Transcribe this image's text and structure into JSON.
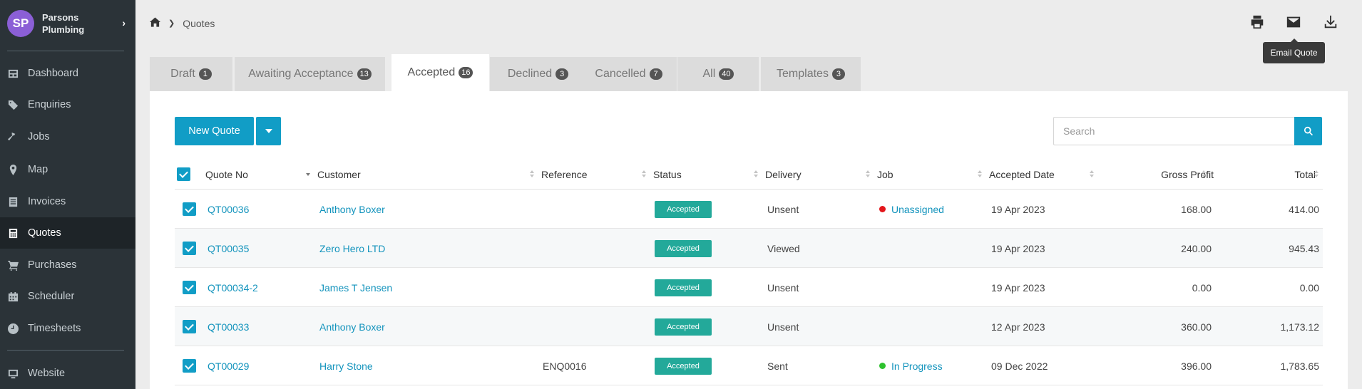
{
  "brand": {
    "initials": "SP",
    "name": "Parsons Plumbing",
    "avatar_color": "#8b5fd6"
  },
  "sidebar": {
    "items": [
      {
        "label": "Dashboard",
        "icon": "dashboard-icon"
      },
      {
        "label": "Enquiries",
        "icon": "tags-icon"
      },
      {
        "label": "Jobs",
        "icon": "hammer-icon"
      },
      {
        "label": "Map",
        "icon": "map-marker-icon"
      },
      {
        "label": "Invoices",
        "icon": "invoice-icon"
      },
      {
        "label": "Quotes",
        "icon": "calculator-icon",
        "active": true
      },
      {
        "label": "Purchases",
        "icon": "cart-icon"
      },
      {
        "label": "Scheduler",
        "icon": "calendar-icon"
      },
      {
        "label": "Timesheets",
        "icon": "clock-icon"
      },
      {
        "label": "Website",
        "icon": "monitor-icon"
      }
    ]
  },
  "breadcrumb": {
    "home_icon": "home-icon",
    "current": "Quotes"
  },
  "toolbar": {
    "print_icon": "print-icon",
    "email_icon": "envelope-icon",
    "download_icon": "download-icon",
    "tooltip": "Email Quote"
  },
  "tabs": [
    {
      "label": "Draft",
      "count": "1"
    },
    {
      "label": "Awaiting Acceptance",
      "count": "13"
    },
    {
      "label": "Accepted",
      "count": "16",
      "active": true
    },
    {
      "label": "Declined",
      "count": "3"
    },
    {
      "label": "Cancelled",
      "count": "7"
    },
    {
      "label": "All",
      "count": "40"
    },
    {
      "label": "Templates",
      "count": "3"
    }
  ],
  "actions": {
    "new_quote": "New Quote",
    "search_placeholder": "Search",
    "search_value": ""
  },
  "table": {
    "columns": [
      "Quote No",
      "Customer",
      "Reference",
      "Status",
      "Delivery",
      "Job",
      "Accepted Date",
      "Gross Profit",
      "Total"
    ],
    "rows": [
      {
        "quote_no": "QT00036",
        "customer": "Anthony Boxer",
        "reference": "",
        "status": "Accepted",
        "delivery": "Unsent",
        "job": "Unassigned",
        "job_color": "#e3161b",
        "accepted_date": "19 Apr 2023",
        "gross_profit": "168.00",
        "total": "414.00"
      },
      {
        "quote_no": "QT00035",
        "customer": "Zero Hero LTD",
        "reference": "",
        "status": "Accepted",
        "delivery": "Viewed",
        "job": "",
        "job_color": "",
        "accepted_date": "19 Apr 2023",
        "gross_profit": "240.00",
        "total": "945.43"
      },
      {
        "quote_no": "QT00034-2",
        "customer": "James T Jensen",
        "reference": "",
        "status": "Accepted",
        "delivery": "Unsent",
        "job": "",
        "job_color": "",
        "accepted_date": "19 Apr 2023",
        "gross_profit": "0.00",
        "total": "0.00"
      },
      {
        "quote_no": "QT00033",
        "customer": "Anthony Boxer",
        "reference": "",
        "status": "Accepted",
        "delivery": "Unsent",
        "job": "",
        "job_color": "",
        "accepted_date": "12 Apr 2023",
        "gross_profit": "360.00",
        "total": "1,173.12"
      },
      {
        "quote_no": "QT00029",
        "customer": "Harry Stone",
        "reference": "ENQ0016",
        "status": "Accepted",
        "delivery": "Sent",
        "job": "In Progress",
        "job_color": "#2ec22e",
        "accepted_date": "09 Dec 2022",
        "gross_profit": "396.00",
        "total": "1,783.65"
      }
    ]
  },
  "colors": {
    "accent": "#119dc6",
    "status_accepted": "#23a99a",
    "sidebar_bg": "#2b3338"
  }
}
